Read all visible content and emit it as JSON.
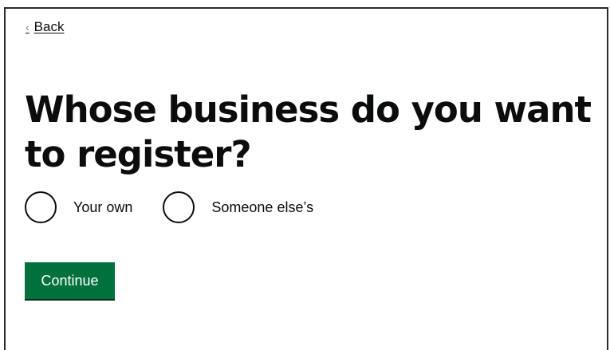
{
  "nav": {
    "back_label": "Back",
    "back_icon": "chevron-left-icon"
  },
  "question": {
    "title": "Whose business do you want to register?"
  },
  "radios": {
    "options": [
      {
        "label": "Your own",
        "selected": false
      },
      {
        "label": "Someone else’s",
        "selected": false
      }
    ]
  },
  "actions": {
    "continue_label": "Continue"
  },
  "colors": {
    "primary_button": "#00703c",
    "text": "#0b0c0c",
    "background": "#ffffff"
  }
}
